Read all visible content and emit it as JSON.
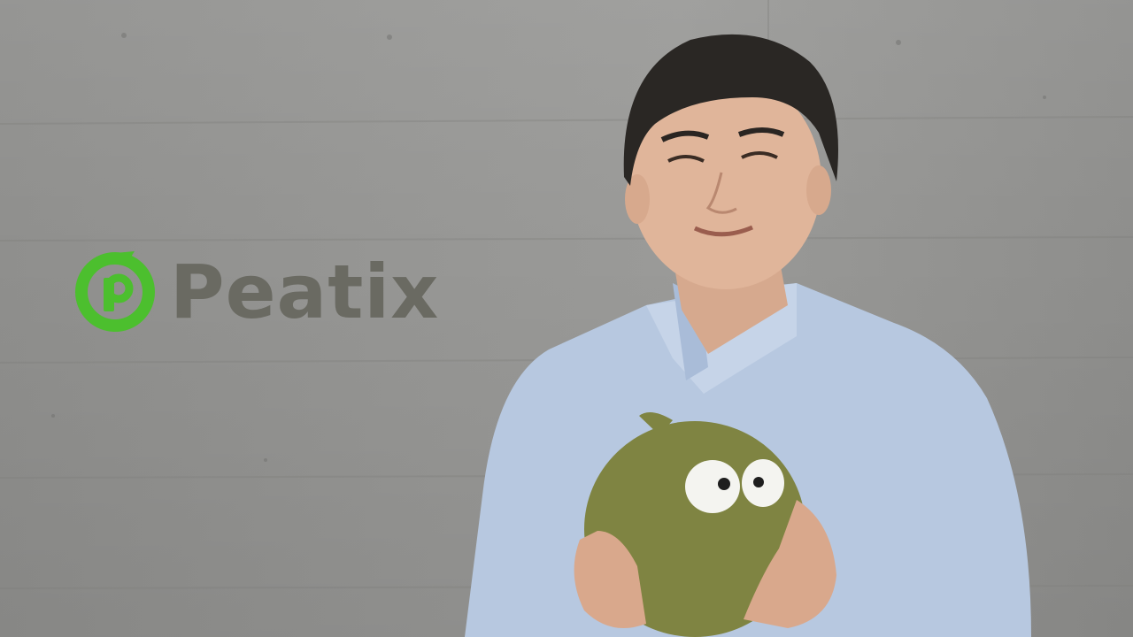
{
  "logo": {
    "text": "Peatix",
    "text_color": "#6a6a62",
    "mark_color": "#4cbf2e"
  },
  "scene": {
    "background_color": "#949492",
    "shirt_color": "#b7c8e0",
    "mascot_color": "#7f8442"
  }
}
